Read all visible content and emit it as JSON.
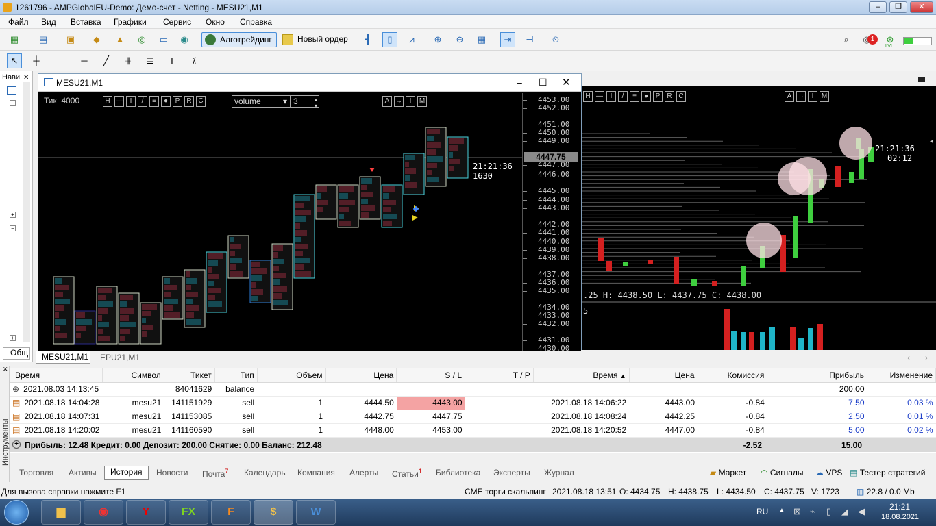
{
  "window": {
    "title": "1261796 - AMPGlobalEU-Demo: Демо-счет - Netting - MESU21,M1"
  },
  "menu": [
    "Файл",
    "Вид",
    "Вставка",
    "Графики",
    "Сервис",
    "Окно",
    "Справка"
  ],
  "toolbar": {
    "algo_label": "Алготрейдинг",
    "new_order_label": "Новый ордер",
    "notify_count": "1",
    "lvl": "LVL"
  },
  "nav": {
    "label": "Нави",
    "bottom_tab": "Общ"
  },
  "chart1": {
    "title": "MESU21,M1",
    "mode": "Тик",
    "ticks": "4000",
    "controls": [
      "H",
      "—",
      "I",
      "/",
      "≡",
      "●",
      "P",
      "R",
      "C"
    ],
    "right_controls": [
      "A",
      "→",
      "I",
      "M"
    ],
    "select_value": "volume",
    "spin_value": "3",
    "price_axis": [
      "4453.00",
      "4452.00",
      "4451.00",
      "4450.00",
      "4449.00",
      "4447.75",
      "4447.00",
      "4446.00",
      "4445.00",
      "4444.00",
      "4443.00",
      "4442.00",
      "4441.00",
      "4440.00",
      "4439.00",
      "4438.00",
      "4437.00",
      "4436.00",
      "4435.00",
      "4434.00",
      "4433.00",
      "4432.00",
      "4431.00",
      "4430.00"
    ],
    "current_price": "4447.75",
    "time_label": "21:21:36",
    "volume_label": "1630"
  },
  "chart2": {
    "controls": [
      "H",
      "—",
      "I",
      "/",
      "≡",
      "●",
      "P",
      "R",
      "C"
    ],
    "right_controls": [
      "A",
      "→",
      "I",
      "M"
    ],
    "time_label": "21:21:36",
    "remaining": "02:12",
    "ohlc": ".25  H: 4438.50  L: 4437.75  C: 4438.00",
    "vol_scale": "5"
  },
  "chart_tabs": [
    "MESU21,M1",
    "EPU21,M1"
  ],
  "history": {
    "columns": [
      "Время",
      "Символ",
      "Тикет",
      "Тип",
      "Объем",
      "Цена",
      "S / L",
      "T / P",
      "Время",
      "Цена",
      "Комиссия",
      "Прибыль",
      "Изменение"
    ],
    "rows": [
      [
        "2021.08.03 14:13:45",
        "",
        "84041629",
        "balance",
        "",
        "",
        "",
        "",
        "",
        "",
        "",
        "200.00",
        ""
      ],
      [
        "2021.08.18 14:04:28",
        "mesu21",
        "141151929",
        "sell",
        "1",
        "4444.50",
        "4443.00",
        "",
        "2021.08.18 14:06:22",
        "4443.00",
        "-0.84",
        "7.50",
        "0.03 %"
      ],
      [
        "2021.08.18 14:07:31",
        "mesu21",
        "141153085",
        "sell",
        "1",
        "4442.75",
        "4447.75",
        "",
        "2021.08.18 14:08:24",
        "4442.25",
        "-0.84",
        "2.50",
        "0.01 %"
      ],
      [
        "2021.08.18 14:20:02",
        "mesu21",
        "141160590",
        "sell",
        "1",
        "4448.00",
        "4453.00",
        "",
        "2021.08.18 14:20:52",
        "4447.00",
        "-0.84",
        "5.00",
        "0.02 %"
      ]
    ],
    "summary": "Прибыль: 12.48  Кредит: 0.00  Депозит: 200.00  Снятие: 0.00  Баланс: 212.48",
    "summary_commission": "-2.52",
    "summary_profit": "15.00",
    "side_label": "Инструменты"
  },
  "bottom_tabs": [
    "Торговля",
    "Активы",
    "История",
    "Новости",
    "Почта",
    "Календарь",
    "Компания",
    "Алерты",
    "Статьи",
    "Библиотека",
    "Эксперты",
    "Журнал"
  ],
  "mail_badge": "7",
  "articles_badge": "1",
  "services": [
    "Маркет",
    "Сигналы",
    "VPS",
    "Тестер стратегий"
  ],
  "status": {
    "help": "Для вызова справки нажмите F1",
    "profile": "CME торги скальпинг",
    "datetime": "2021.08.18 13:51",
    "open": "O: 4434.75",
    "high": "H: 4438.75",
    "low": "L: 4434.50",
    "close": "C: 4437.75",
    "volume": "V: 1723",
    "traffic": "22.8 / 0.0 Mb"
  },
  "taskbar": {
    "lang": "RU",
    "time": "21:21",
    "date": "18.08.2021"
  },
  "colors": {
    "selected_sl": "#f4a3a3",
    "bull": "#3fcf3f",
    "bear": "#d42020",
    "volume_bull": "#1fb5c8"
  }
}
